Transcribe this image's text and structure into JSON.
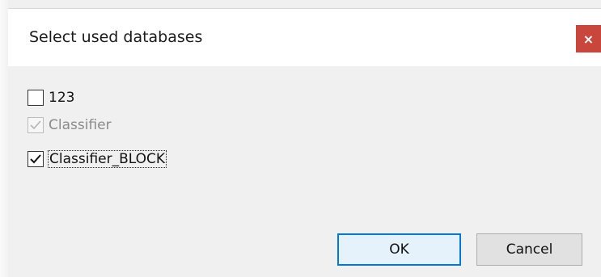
{
  "dialog": {
    "title": "Select used databases",
    "close_glyph": "×",
    "close_icon": "close-icon"
  },
  "databases": [
    {
      "name": "123",
      "checked": false,
      "enabled": true,
      "focused": false
    },
    {
      "name": "Classifier",
      "checked": true,
      "enabled": false,
      "focused": false
    },
    {
      "name": "Classifier_BLOCK",
      "checked": true,
      "enabled": true,
      "focused": true
    }
  ],
  "buttons": {
    "ok_label": "OK",
    "cancel_label": "Cancel"
  },
  "colors": {
    "close_button": "#c9463d",
    "default_button_border": "#0078d7",
    "dialog_background": "#f0f0f0"
  }
}
